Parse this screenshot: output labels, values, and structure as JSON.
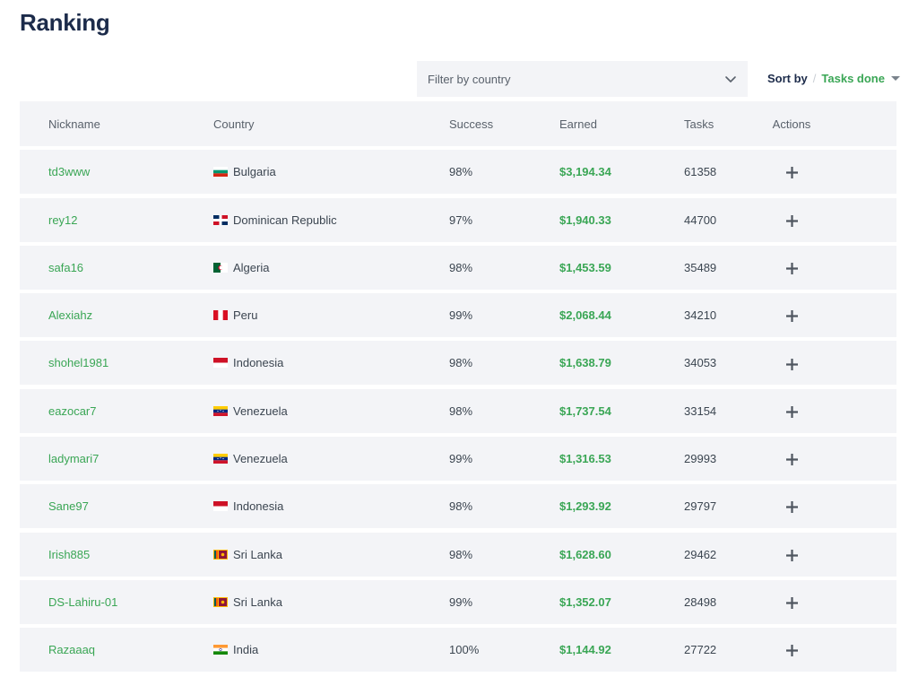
{
  "page": {
    "title": "Ranking"
  },
  "filter": {
    "placeholder": "Filter by country",
    "icon": "chevron-down-icon"
  },
  "sort": {
    "label": "Sort by",
    "separator": "/",
    "value": "Tasks done",
    "icon": "caret-down-icon"
  },
  "colors": {
    "accent_green": "#3aa655",
    "heading_navy": "#1c2b4a",
    "row_bg": "#f3f4f7"
  },
  "table": {
    "headers": {
      "nickname": "Nickname",
      "country": "Country",
      "success": "Success",
      "earned": "Earned",
      "tasks": "Tasks",
      "actions": "Actions"
    },
    "rows": [
      {
        "nickname": "td3www",
        "country": "Bulgaria",
        "flag": "bulgaria-flag-icon",
        "success": "98%",
        "earned": "$3,194.34",
        "tasks": "61358",
        "action_icon": "plus-icon"
      },
      {
        "nickname": "rey12",
        "country": "Dominican Republic",
        "flag": "dominican-republic-flag-icon",
        "success": "97%",
        "earned": "$1,940.33",
        "tasks": "44700",
        "action_icon": "plus-icon"
      },
      {
        "nickname": "safa16",
        "country": "Algeria",
        "flag": "algeria-flag-icon",
        "success": "98%",
        "earned": "$1,453.59",
        "tasks": "35489",
        "action_icon": "plus-icon"
      },
      {
        "nickname": "Alexiahz",
        "country": "Peru",
        "flag": "peru-flag-icon",
        "success": "99%",
        "earned": "$2,068.44",
        "tasks": "34210",
        "action_icon": "plus-icon"
      },
      {
        "nickname": "shohel1981",
        "country": "Indonesia",
        "flag": "indonesia-flag-icon",
        "success": "98%",
        "earned": "$1,638.79",
        "tasks": "34053",
        "action_icon": "plus-icon"
      },
      {
        "nickname": "eazocar7",
        "country": "Venezuela",
        "flag": "venezuela-flag-icon",
        "success": "98%",
        "earned": "$1,737.54",
        "tasks": "33154",
        "action_icon": "plus-icon"
      },
      {
        "nickname": "ladymari7",
        "country": "Venezuela",
        "flag": "venezuela-flag-icon",
        "success": "99%",
        "earned": "$1,316.53",
        "tasks": "29993",
        "action_icon": "plus-icon"
      },
      {
        "nickname": "Sane97",
        "country": "Indonesia",
        "flag": "indonesia-flag-icon",
        "success": "98%",
        "earned": "$1,293.92",
        "tasks": "29797",
        "action_icon": "plus-icon"
      },
      {
        "nickname": "Irish885",
        "country": "Sri Lanka",
        "flag": "sri-lanka-flag-icon",
        "success": "98%",
        "earned": "$1,628.60",
        "tasks": "29462",
        "action_icon": "plus-icon"
      },
      {
        "nickname": "DS-Lahiru-01",
        "country": "Sri Lanka",
        "flag": "sri-lanka-flag-icon",
        "success": "99%",
        "earned": "$1,352.07",
        "tasks": "28498",
        "action_icon": "plus-icon"
      },
      {
        "nickname": "Razaaaq",
        "country": "India",
        "flag": "india-flag-icon",
        "success": "100%",
        "earned": "$1,144.92",
        "tasks": "27722",
        "action_icon": "plus-icon"
      }
    ]
  }
}
